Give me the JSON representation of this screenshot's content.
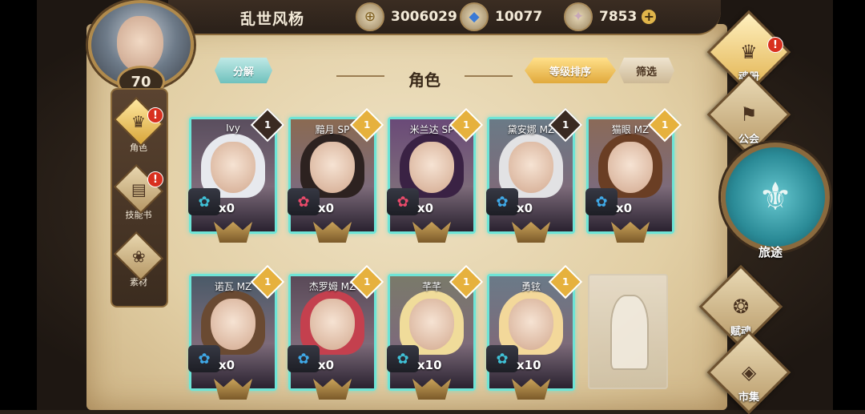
{
  "player": {
    "name": "乱世风杨",
    "level": "70"
  },
  "resources": [
    {
      "icon": "coin-icon",
      "glyph": "⊕",
      "value": "3006029"
    },
    {
      "icon": "crystal-icon",
      "glyph": "◆",
      "value": "10077"
    },
    {
      "icon": "gem-icon",
      "glyph": "✦",
      "value": "7853",
      "plus": "+"
    }
  ],
  "left_nav": [
    {
      "label": "角色",
      "glyph": "♛",
      "alert": "!",
      "active": true
    },
    {
      "label": "技能书",
      "glyph": "▤",
      "alert": "!",
      "active": false
    },
    {
      "label": "素材",
      "glyph": "❀",
      "alert": "",
      "active": false
    }
  ],
  "header": {
    "decompose": "分解",
    "title": "角色",
    "sort": "等级排序",
    "filter": "筛选"
  },
  "cards": [
    {
      "name": "Ivy",
      "rank": "1",
      "rank_style": "dark",
      "count": "x0",
      "gem": "✿",
      "gem_color": "#3fc1d6",
      "hair": "#e7e9ee",
      "bg": "#5a4e5e"
    },
    {
      "name": "黯月 SP",
      "rank": "1",
      "rank_style": "gold",
      "count": "x0",
      "gem": "✿",
      "gem_color": "#e84a6a",
      "hair": "#2d2220",
      "bg": "#8a6a52"
    },
    {
      "name": "米兰达 SP",
      "rank": "1",
      "rank_style": "gold",
      "count": "x0",
      "gem": "✿",
      "gem_color": "#e84a6a",
      "hair": "#3a2244",
      "bg": "#6a4a78"
    },
    {
      "name": "黛安娜 MZ",
      "rank": "1",
      "rank_style": "dark",
      "count": "x0",
      "gem": "✿",
      "gem_color": "#3fa8e6",
      "hair": "#e2e2e4",
      "bg": "#6a7a86"
    },
    {
      "name": "猫眼 MZ",
      "rank": "1",
      "rank_style": "gold",
      "count": "x0",
      "gem": "✿",
      "gem_color": "#3fa8e6",
      "hair": "#6a3e24",
      "bg": "#8a6a58"
    },
    {
      "name": "诺瓦 MZ",
      "rank": "1",
      "rank_style": "gold",
      "count": "x0",
      "gem": "✿",
      "gem_color": "#3fa8e6",
      "hair": "#6a4a32",
      "bg": "#4a5a68"
    },
    {
      "name": "杰罗姆 MZ",
      "rank": "1",
      "rank_style": "gold",
      "count": "x0",
      "gem": "✿",
      "gem_color": "#3fa8e6",
      "hair": "#c4404e",
      "bg": "#5a4a58"
    },
    {
      "name": "芊芊",
      "rank": "1",
      "rank_style": "gold",
      "count": "x10",
      "gem": "✿",
      "gem_color": "#3fc1d6",
      "hair": "#f0dc9a",
      "bg": "#7a7a6a"
    },
    {
      "name": "勇铉",
      "rank": "1",
      "rank_style": "gold",
      "count": "x10",
      "gem": "✿",
      "gem_color": "#3fc1d6",
      "hair": "#f3d89a",
      "bg": "#6a7a88"
    }
  ],
  "right_nav": [
    {
      "label": "魂册",
      "glyph": "♛",
      "alert": "!",
      "active": true
    },
    {
      "label": "公会",
      "glyph": "⚑",
      "alert": "",
      "active": false
    },
    {
      "label": "赋魂",
      "glyph": "❂",
      "alert": "",
      "active": false
    },
    {
      "label": "市集",
      "glyph": "◈",
      "alert": "",
      "active": false
    }
  ],
  "journey": {
    "label": "旅途",
    "glyph": "⚜"
  }
}
